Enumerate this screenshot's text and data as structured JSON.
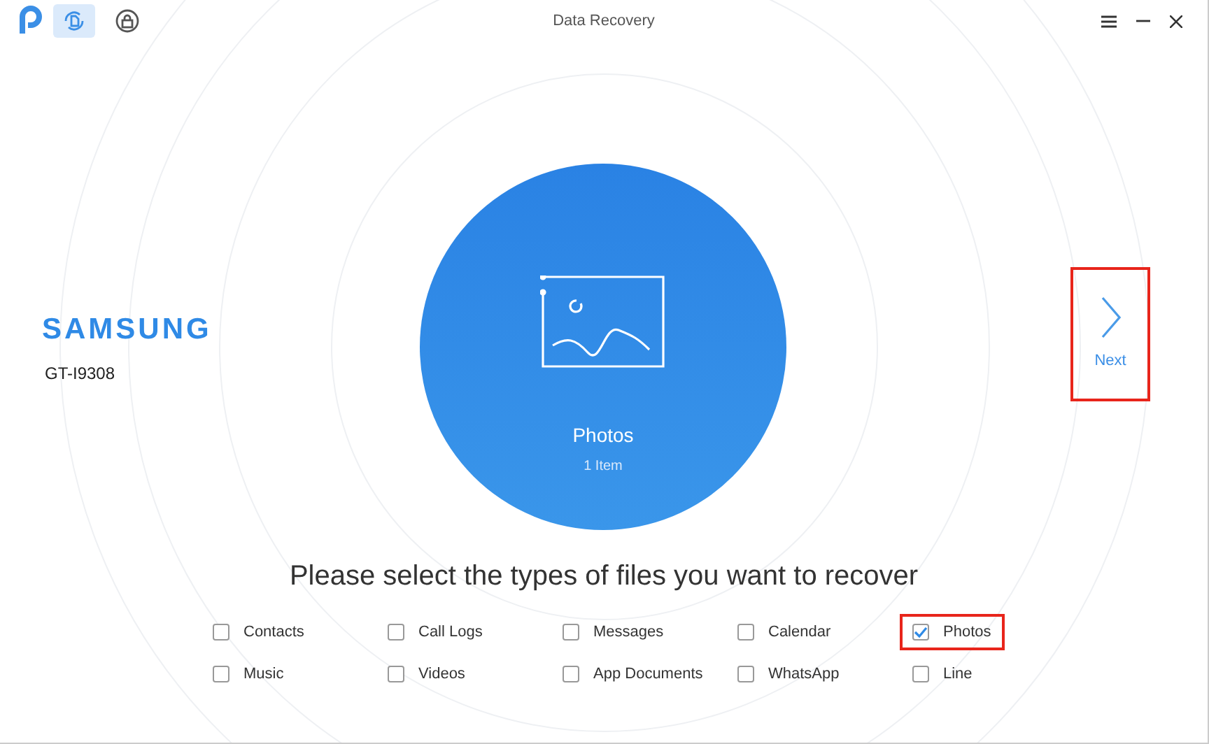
{
  "window": {
    "title": "Data Recovery",
    "tabs": [
      {
        "kind": "recovery",
        "selected": true
      },
      {
        "kind": "unlock",
        "selected": false
      }
    ]
  },
  "device": {
    "brand": "SAMSUNG",
    "model": "GT-I9308"
  },
  "preview": {
    "label": "Photos",
    "count": "1 Item"
  },
  "next": {
    "label": "Next",
    "highlighted": true
  },
  "heading": "Please select the types of files you want to recover",
  "file_types": [
    {
      "label": "Contacts",
      "checked": false,
      "highlighted": false
    },
    {
      "label": "Call Logs",
      "checked": false,
      "highlighted": false
    },
    {
      "label": "Messages",
      "checked": false,
      "highlighted": false
    },
    {
      "label": "Calendar",
      "checked": false,
      "highlighted": false
    },
    {
      "label": "Photos",
      "checked": true,
      "highlighted": true
    },
    {
      "label": "Music",
      "checked": false,
      "highlighted": false
    },
    {
      "label": "Videos",
      "checked": false,
      "highlighted": false
    },
    {
      "label": "App Documents",
      "checked": false,
      "highlighted": false
    },
    {
      "label": "WhatsApp",
      "checked": false,
      "highlighted": false
    },
    {
      "label": "Line",
      "checked": false,
      "highlighted": false
    }
  ]
}
